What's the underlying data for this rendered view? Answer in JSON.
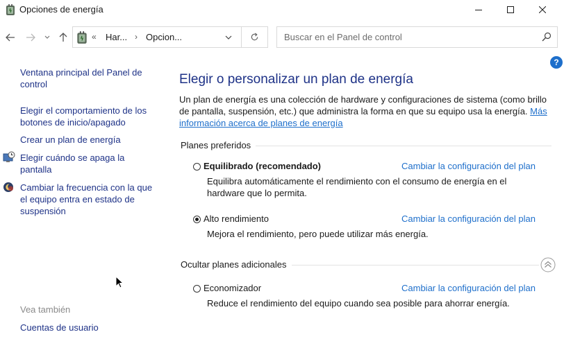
{
  "window": {
    "title": "Opciones de energía",
    "icons": {
      "app": "power-options-icon",
      "minimize": "minimize-icon",
      "maximize": "maximize-icon",
      "close": "close-icon"
    }
  },
  "nav": {
    "icons": {
      "back": "back-arrow-icon",
      "forward": "forward-arrow-icon",
      "recent": "chevron-down-icon",
      "up": "up-arrow-icon"
    },
    "address": {
      "chevron": "«",
      "breadcrumbs": [
        "Har...",
        "Opcion..."
      ],
      "separator": "›"
    },
    "search_placeholder": "Buscar en el Panel de control"
  },
  "help_label": "?",
  "left_pane": {
    "items": [
      {
        "label": "Ventana principal del Panel de control"
      },
      {
        "label": "Elegir el comportamiento de los botones de inicio/apagado"
      },
      {
        "label": "Crear un plan de energía"
      },
      {
        "label": "Elegir cuándo se apaga la pantalla",
        "icon": "display-clock-icon"
      },
      {
        "label": "Cambiar la frecuencia con la que el equipo entra en estado de suspensión",
        "icon": "moon-icon"
      }
    ],
    "see_also": {
      "heading": "Vea también",
      "items": [
        {
          "label": "Cuentas de usuario"
        }
      ]
    }
  },
  "main": {
    "title": "Elegir o personalizar un plan de energía",
    "intro_text": "Un plan de energía es una colección de hardware y configuraciones de sistema (como brillo de pantalla, suspensión, etc.) que administra la forma en que su equipo usa la energía.",
    "intro_link": "Más información acerca de planes de energía",
    "preferred": {
      "label": "Planes preferidos",
      "plans": [
        {
          "name": "Equilibrado (recomendado)",
          "selected": false,
          "bold": true,
          "description": "Equilibra automáticamente el rendimiento con el consumo de energía en el hardware que lo permita.",
          "link": "Cambiar la configuración del plan"
        },
        {
          "name": "Alto rendimiento",
          "selected": true,
          "bold": false,
          "description": "Mejora el rendimiento, pero puede utilizar más energía.",
          "link": "Cambiar la configuración del plan"
        }
      ]
    },
    "additional": {
      "label": "Ocultar planes adicionales",
      "plans": [
        {
          "name": "Economizador",
          "selected": false,
          "bold": false,
          "description": "Reduce el rendimiento del equipo cuando sea posible para ahorrar energía.",
          "link": "Cambiar la configuración del plan"
        }
      ]
    }
  },
  "colors": {
    "link": "#1e6fcb",
    "heading": "#1e3287",
    "help": "#1e6fcb"
  }
}
